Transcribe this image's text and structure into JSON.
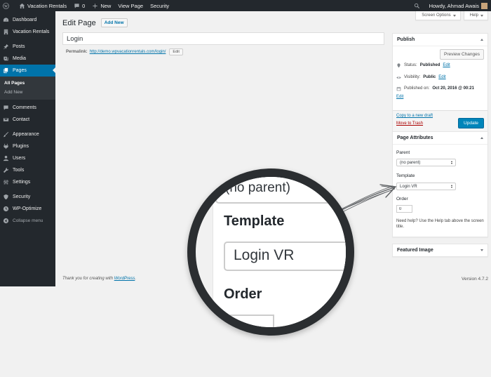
{
  "admin_bar": {
    "site_name": "Vacation Rentals",
    "comments_count": "0",
    "new_label": "New",
    "view_page_label": "View Page",
    "security_label": "Security",
    "howdy_label": "Howdy, Ahmad Awais"
  },
  "sidebar": {
    "items": [
      {
        "label": "Dashboard",
        "icon": "dashboard-icon"
      },
      {
        "label": "Vacation Rentals",
        "icon": "building-icon"
      },
      {
        "label": "Posts",
        "icon": "pin-icon"
      },
      {
        "label": "Media",
        "icon": "media-icon"
      },
      {
        "label": "Pages",
        "icon": "pages-icon"
      },
      {
        "label": "Comments",
        "icon": "comment-icon"
      },
      {
        "label": "Contact",
        "icon": "mail-icon"
      },
      {
        "label": "Appearance",
        "icon": "brush-icon"
      },
      {
        "label": "Plugins",
        "icon": "plugin-icon"
      },
      {
        "label": "Users",
        "icon": "user-icon"
      },
      {
        "label": "Tools",
        "icon": "wrench-icon"
      },
      {
        "label": "Settings",
        "icon": "settings-icon"
      },
      {
        "label": "Security",
        "icon": "shield-icon"
      },
      {
        "label": "WP-Optimize",
        "icon": "optimize-icon"
      }
    ],
    "submenu": {
      "all_pages": "All Pages",
      "add_new": "Add New"
    },
    "collapse_label": "Collapse menu"
  },
  "screen_tabs": {
    "screen_options": "Screen Options",
    "help": "Help"
  },
  "page": {
    "heading": "Edit Page",
    "add_new": "Add New",
    "title_value": "Login",
    "permalink_label": "Permalink:",
    "permalink_url": "http://demo.wpvacationrentals.com/login/",
    "permalink_edit": "Edit"
  },
  "publish": {
    "title": "Publish",
    "preview_button": "Preview Changes",
    "status_label": "Status:",
    "status_value": "Published",
    "visibility_label": "Visibility:",
    "visibility_value": "Public",
    "published_label": "Published on:",
    "published_value": "Oct 20, 2016 @ 00:21",
    "edit_link": "Edit",
    "copy_draft": "Copy to a new draft",
    "move_trash": "Move to Trash",
    "update_button": "Update"
  },
  "page_attributes": {
    "title": "Page Attributes",
    "parent_label": "Parent",
    "parent_value": "(no parent)",
    "template_label": "Template",
    "template_value": "Login VR",
    "order_label": "Order",
    "order_value": "0",
    "help_text": "Need help? Use the Help tab above the screen title."
  },
  "featured_image": {
    "title": "Featured Image"
  },
  "footer": {
    "thanks_prefix": "Thank you for creating with",
    "thanks_link": "WordPress",
    "thanks_suffix": ".",
    "version": "Version 4.7.2"
  },
  "colors": {
    "admin_dark": "#23282d",
    "accent_blue": "#0073aa",
    "primary_button": "#0085ba",
    "trash_red": "#aa0000",
    "background": "#f1f1f1"
  }
}
